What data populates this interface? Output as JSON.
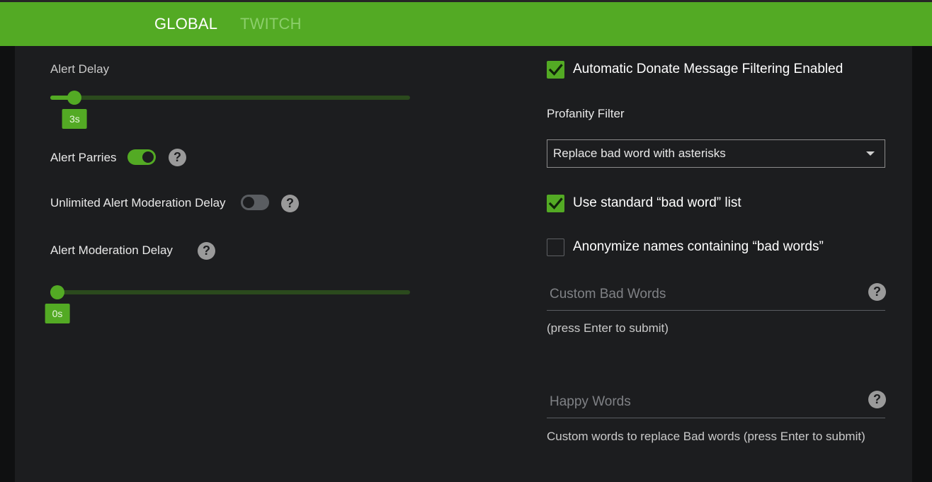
{
  "tabs": [
    {
      "label": "GLOBAL",
      "active": true
    },
    {
      "label": "TWITCH",
      "active": false
    }
  ],
  "left": {
    "alert_delay": {
      "label": "Alert Delay",
      "value": 3,
      "min": 0,
      "max": 60,
      "value_label": "3s"
    },
    "alert_parries": {
      "label": "Alert Parries",
      "enabled": true
    },
    "unlimited_moderation_delay": {
      "label": "Unlimited Alert Moderation Delay",
      "enabled": false
    },
    "moderation_delay": {
      "label": "Alert Moderation Delay",
      "value": 0,
      "min": 0,
      "max": 60,
      "value_label": "0s"
    }
  },
  "right": {
    "auto_filter": {
      "label": "Automatic Donate Message Filtering Enabled",
      "checked": true
    },
    "profanity_filter": {
      "label": "Profanity Filter",
      "selected": "Replace bad word with asterisks"
    },
    "standard_list": {
      "label": "Use standard “bad word” list",
      "checked": true
    },
    "anonymize": {
      "label": "Anonymize names containing “bad words”",
      "checked": false
    },
    "custom_bad_words": {
      "placeholder": "Custom Bad Words",
      "value": "",
      "hint": "(press Enter to submit)"
    },
    "happy_words": {
      "placeholder": "Happy Words",
      "value": "",
      "hint": "Custom words to replace Bad words (press Enter to submit)"
    }
  },
  "icons": {
    "help": "help-circle-icon",
    "check": "checkmark-icon",
    "caret": "caret-down-icon"
  },
  "colors": {
    "accent": "#53aa24",
    "panel": "#1c1d1f",
    "background": "#0f1011"
  }
}
